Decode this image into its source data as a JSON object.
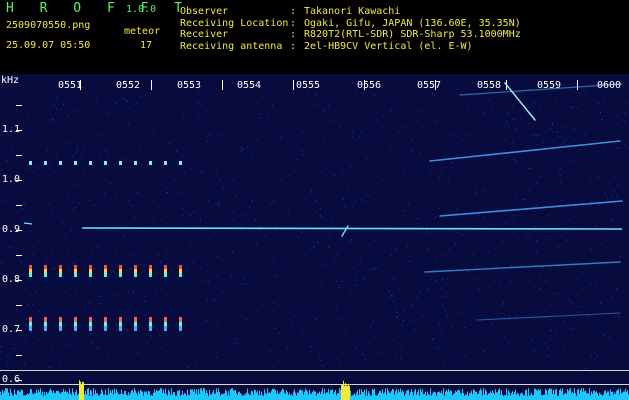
{
  "header": {
    "logo": "H R O F F T",
    "version": "1.0.0",
    "filename": "2509070550.png",
    "datetime": "25.09.07 05:50",
    "meteor_label": "meteor",
    "meteor_count": "17"
  },
  "info": [
    {
      "key": "Observer",
      "sep": ":",
      "value": "Takanori Kawachi"
    },
    {
      "key": "Receiving Location",
      "sep": ":",
      "value": "Ogaki, Gifu, JAPAN (136.60E, 35.35N)"
    },
    {
      "key": "Receiver",
      "sep": ":",
      "value": "R820T2(RTL-SDR) SDR-Sharp 53.1000MHz"
    },
    {
      "key": "Receiving antenna",
      "sep": ":",
      "value": "2el-HB9CV Vertical (el. E-W)"
    }
  ],
  "spectrogram": {
    "y_unit": "kHz",
    "time_labels": [
      "0551",
      "0552",
      "0553",
      "0554",
      "0555",
      "0556",
      "0557",
      "0558",
      "0559",
      "0600"
    ],
    "freq_labels": [
      "1.1",
      "1.0",
      "0.9",
      "0.8",
      "0.7",
      "0.6"
    ],
    "colors": {
      "background": "#070b3d",
      "carrier": "#6fe0ff",
      "ticks": "#ffffff",
      "noise": "#1ec8ff",
      "spike": "#f2ea3a"
    }
  }
}
